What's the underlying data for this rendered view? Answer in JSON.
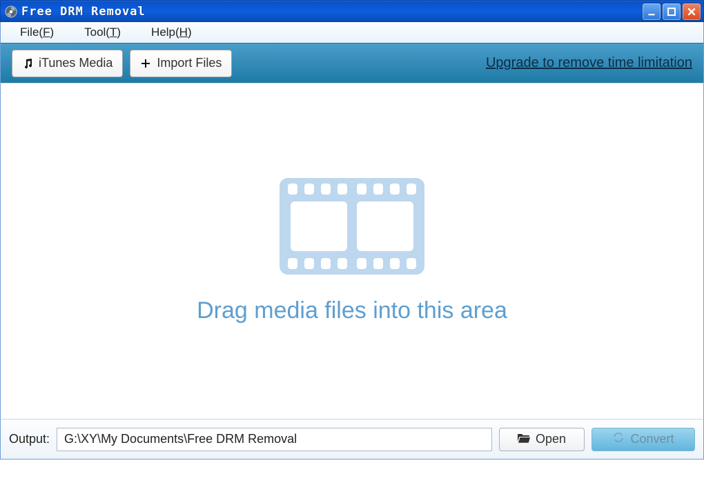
{
  "titlebar": {
    "title": "Free DRM Removal",
    "icons": {
      "app": "app-icon",
      "min": "minimize-icon",
      "max": "maximize-icon",
      "close": "close-icon"
    }
  },
  "menubar": {
    "file_label": "File(",
    "file_key": "F",
    "file_close": ")",
    "tool_label": "Tool(",
    "tool_key": "T",
    "tool_close": ")",
    "help_label": "Help(",
    "help_key": "H",
    "help_close": ")"
  },
  "toolbar": {
    "itunes_label": "iTunes Media",
    "import_label": "Import Files",
    "upgrade_label": "Upgrade to remove time limitation"
  },
  "droparea": {
    "text": "Drag media files into this area"
  },
  "bottombar": {
    "output_label": "Output:",
    "output_path": "G:\\XY\\My Documents\\Free DRM Removal",
    "open_label": "Open",
    "convert_label": "Convert"
  },
  "colors": {
    "title_gradient_top": "#2a6ad6",
    "title_gradient_bottom": "#083c95",
    "toolbar_gradient_top": "#4a9dc9",
    "toolbar_gradient_bottom": "#1f7aa6",
    "accent": "#5e9ecf",
    "close_button": "#da4a1b"
  }
}
